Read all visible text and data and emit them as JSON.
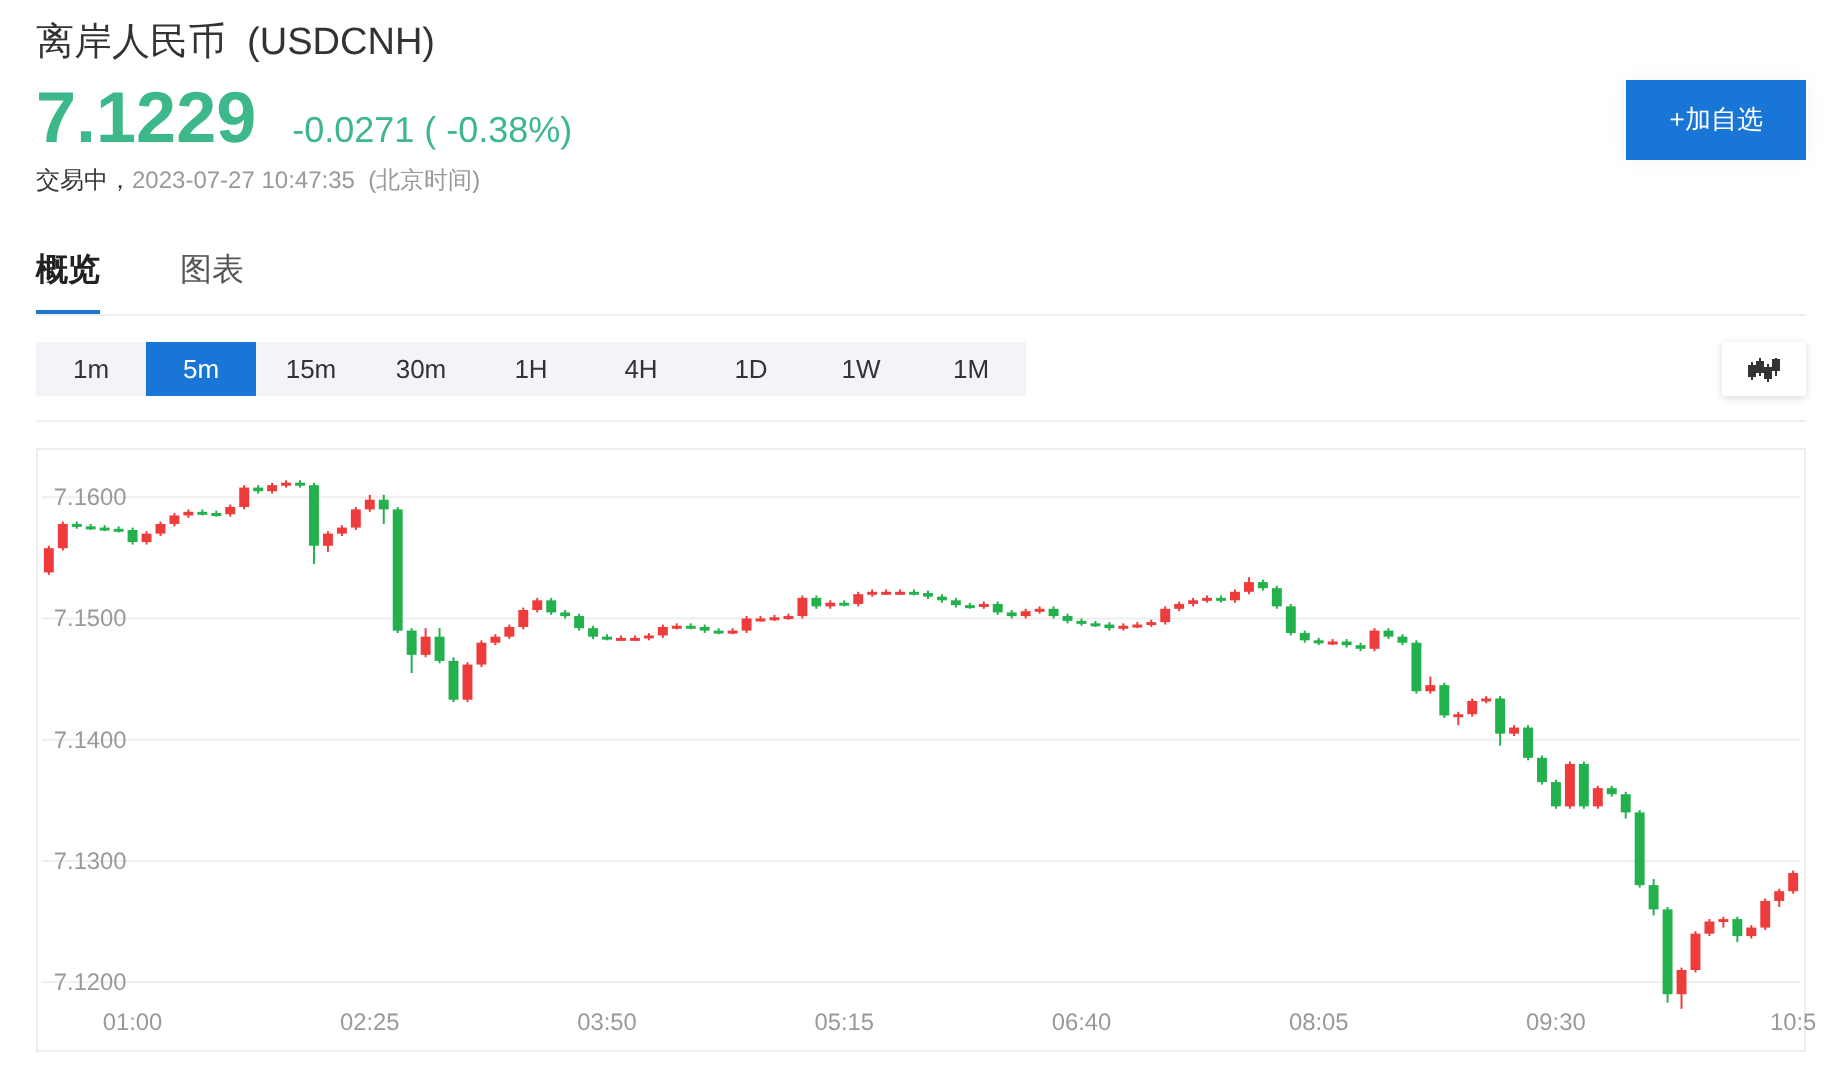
{
  "header": {
    "title": "离岸人民币  (USDCNH)",
    "price": "7.1229",
    "change": "-0.0271 ( -0.38%)",
    "status": "交易中，",
    "time": "2023-07-27 10:47:35  (北京时间)",
    "watch_button": "+加自选"
  },
  "tabs": [
    {
      "label": "概览",
      "selected": true
    },
    {
      "label": "图表",
      "selected": false
    }
  ],
  "periods": [
    {
      "label": "1m",
      "selected": false
    },
    {
      "label": "5m",
      "selected": true
    },
    {
      "label": "15m",
      "selected": false
    },
    {
      "label": "30m",
      "selected": false
    },
    {
      "label": "1H",
      "selected": false
    },
    {
      "label": "4H",
      "selected": false
    },
    {
      "label": "1D",
      "selected": false
    },
    {
      "label": "1W",
      "selected": false
    },
    {
      "label": "1M",
      "selected": false
    }
  ],
  "chart": {
    "chart_data": {
      "type": "candlestick",
      "grid": true,
      "ylim": [
        7.1144,
        7.1639
      ],
      "yticks": [
        {
          "value": 7.16,
          "label": "7.1600"
        },
        {
          "value": 7.15,
          "label": "7.1500"
        },
        {
          "value": 7.14,
          "label": "7.1400"
        },
        {
          "value": 7.13,
          "label": "7.1300"
        },
        {
          "value": 7.12,
          "label": "7.1200"
        }
      ],
      "categories": [
        null,
        null,
        null,
        null,
        null,
        null,
        "01:00",
        null,
        null,
        null,
        null,
        null,
        null,
        null,
        null,
        null,
        null,
        null,
        null,
        null,
        null,
        null,
        null,
        "02:25",
        null,
        null,
        null,
        null,
        null,
        null,
        null,
        null,
        null,
        null,
        null,
        null,
        null,
        null,
        null,
        null,
        "03:50",
        null,
        null,
        null,
        null,
        null,
        null,
        null,
        null,
        null,
        null,
        null,
        null,
        null,
        null,
        null,
        null,
        "05:15",
        null,
        null,
        null,
        null,
        null,
        null,
        null,
        null,
        null,
        null,
        null,
        null,
        null,
        null,
        null,
        null,
        "06:40",
        null,
        null,
        null,
        null,
        null,
        null,
        null,
        null,
        null,
        null,
        null,
        null,
        null,
        null,
        null,
        null,
        "08:05",
        null,
        null,
        null,
        null,
        null,
        null,
        null,
        null,
        null,
        null,
        null,
        null,
        null,
        null,
        null,
        null,
        "09:30",
        null,
        null,
        null,
        null,
        null,
        null,
        null,
        null,
        null,
        null,
        null,
        null,
        null,
        null,
        null,
        null,
        "10:5"
      ],
      "ohlc": [
        [
          7.1538,
          7.156,
          7.1536,
          7.1558
        ],
        [
          7.1558,
          7.158,
          7.1556,
          7.1578
        ],
        [
          7.1578,
          7.158,
          7.1574,
          7.1576
        ],
        [
          7.1576,
          7.1578,
          7.1573,
          7.1575
        ],
        [
          7.1575,
          7.1577,
          7.1572,
          7.1574
        ],
        [
          7.1574,
          7.1576,
          7.1571,
          7.1573
        ],
        [
          7.1573,
          7.1575,
          7.1561,
          7.1563
        ],
        [
          7.1563,
          7.1572,
          7.1561,
          7.157
        ],
        [
          7.157,
          7.158,
          7.1568,
          7.1578
        ],
        [
          7.1578,
          7.1587,
          7.1576,
          7.1585
        ],
        [
          7.1585,
          7.159,
          7.1583,
          7.1588
        ],
        [
          7.1588,
          7.159,
          7.1585,
          7.1587
        ],
        [
          7.1587,
          7.1589,
          7.1584,
          7.1586
        ],
        [
          7.1586,
          7.1594,
          7.1584,
          7.1592
        ],
        [
          7.1592,
          7.161,
          7.159,
          7.1608
        ],
        [
          7.1608,
          7.161,
          7.1603,
          7.1605
        ],
        [
          7.1605,
          7.1612,
          7.1603,
          7.161
        ],
        [
          7.161,
          7.1614,
          7.1608,
          7.1612
        ],
        [
          7.1612,
          7.1614,
          7.1608,
          7.161
        ],
        [
          7.161,
          7.1612,
          7.1545,
          7.156
        ],
        [
          7.156,
          7.1572,
          7.1555,
          7.157
        ],
        [
          7.157,
          7.1577,
          7.1568,
          7.1575
        ],
        [
          7.1575,
          7.1592,
          7.1573,
          7.159
        ],
        [
          7.159,
          7.1602,
          7.1588,
          7.1598
        ],
        [
          7.1598,
          7.1602,
          7.1578,
          7.159
        ],
        [
          7.159,
          7.1592,
          7.1488,
          7.149
        ],
        [
          7.149,
          7.1492,
          7.1455,
          7.147
        ],
        [
          7.147,
          7.1492,
          7.1468,
          7.1485
        ],
        [
          7.1485,
          7.1492,
          7.1463,
          7.1465
        ],
        [
          7.1465,
          7.1468,
          7.1431,
          7.1433
        ],
        [
          7.1433,
          7.1464,
          7.1431,
          7.1462
        ],
        [
          7.1462,
          7.1482,
          7.146,
          7.148
        ],
        [
          7.148,
          7.1487,
          7.1478,
          7.1485
        ],
        [
          7.1485,
          7.1495,
          7.1483,
          7.1493
        ],
        [
          7.1493,
          7.1509,
          7.1491,
          7.1507
        ],
        [
          7.1507,
          7.1517,
          7.1505,
          7.1515
        ],
        [
          7.1515,
          7.1517,
          7.1503,
          7.1505
        ],
        [
          7.1505,
          7.1507,
          7.15,
          7.1502
        ],
        [
          7.1502,
          7.1504,
          7.149,
          7.1492
        ],
        [
          7.1492,
          7.1494,
          7.1483,
          7.1485
        ],
        [
          7.1485,
          7.1487,
          7.1482,
          7.1484
        ],
        [
          7.1484,
          7.1486,
          7.1482,
          7.1484
        ],
        [
          7.1484,
          7.1486,
          7.1482,
          7.1484
        ],
        [
          7.1484,
          7.1488,
          7.1482,
          7.1486
        ],
        [
          7.1486,
          7.1495,
          7.1484,
          7.1493
        ],
        [
          7.1493,
          7.1496,
          7.1491,
          7.1494
        ],
        [
          7.1494,
          7.1496,
          7.1491,
          7.1493
        ],
        [
          7.1493,
          7.1495,
          7.1488,
          7.149
        ],
        [
          7.149,
          7.1492,
          7.1487,
          7.1489
        ],
        [
          7.1489,
          7.1492,
          7.1487,
          7.149
        ],
        [
          7.149,
          7.1502,
          7.1488,
          7.15
        ],
        [
          7.15,
          7.1502,
          7.1498,
          7.15
        ],
        [
          7.15,
          7.1503,
          7.1498,
          7.1501
        ],
        [
          7.1501,
          7.1504,
          7.1499,
          7.1502
        ],
        [
          7.1502,
          7.1519,
          7.15,
          7.1517
        ],
        [
          7.1517,
          7.1519,
          7.1508,
          7.151
        ],
        [
          7.151,
          7.1515,
          7.1508,
          7.1513
        ],
        [
          7.1513,
          7.1515,
          7.151,
          7.1512
        ],
        [
          7.1512,
          7.1522,
          7.151,
          7.152
        ],
        [
          7.152,
          7.1524,
          7.1518,
          7.1522
        ],
        [
          7.1522,
          7.1524,
          7.152,
          7.1522
        ],
        [
          7.1522,
          7.1524,
          7.152,
          7.1522
        ],
        [
          7.1522,
          7.1524,
          7.1519,
          7.1521
        ],
        [
          7.1521,
          7.1523,
          7.1516,
          7.1518
        ],
        [
          7.1518,
          7.152,
          7.1513,
          7.1515
        ],
        [
          7.1515,
          7.1517,
          7.1509,
          7.1511
        ],
        [
          7.1511,
          7.1513,
          7.1508,
          7.151
        ],
        [
          7.151,
          7.1514,
          7.1508,
          7.1512
        ],
        [
          7.1512,
          7.1514,
          7.1503,
          7.1505
        ],
        [
          7.1505,
          7.1507,
          7.15,
          7.1502
        ],
        [
          7.1502,
          7.1508,
          7.15,
          7.1506
        ],
        [
          7.1506,
          7.151,
          7.1504,
          7.1508
        ],
        [
          7.1508,
          7.151,
          7.15,
          7.1502
        ],
        [
          7.1502,
          7.1504,
          7.1496,
          7.1498
        ],
        [
          7.1498,
          7.15,
          7.1494,
          7.1496
        ],
        [
          7.1496,
          7.1498,
          7.1493,
          7.1495
        ],
        [
          7.1495,
          7.1497,
          7.149,
          7.1492
        ],
        [
          7.1492,
          7.1496,
          7.149,
          7.1494
        ],
        [
          7.1494,
          7.1497,
          7.1492,
          7.1495
        ],
        [
          7.1495,
          7.1499,
          7.1493,
          7.1497
        ],
        [
          7.1497,
          7.151,
          7.1495,
          7.1508
        ],
        [
          7.1508,
          7.1514,
          7.1506,
          7.1512
        ],
        [
          7.1512,
          7.1517,
          7.151,
          7.1515
        ],
        [
          7.1515,
          7.1519,
          7.1513,
          7.1517
        ],
        [
          7.1517,
          7.1519,
          7.1513,
          7.1515
        ],
        [
          7.1515,
          7.1524,
          7.1513,
          7.1522
        ],
        [
          7.1522,
          7.1534,
          7.152,
          7.153
        ],
        [
          7.153,
          7.1532,
          7.1523,
          7.1525
        ],
        [
          7.1525,
          7.1527,
          7.1508,
          7.151
        ],
        [
          7.151,
          7.1512,
          7.1486,
          7.1488
        ],
        [
          7.1488,
          7.149,
          7.148,
          7.1482
        ],
        [
          7.1482,
          7.1484,
          7.1478,
          7.148
        ],
        [
          7.148,
          7.1483,
          7.1478,
          7.1481
        ],
        [
          7.1481,
          7.1483,
          7.1476,
          7.1478
        ],
        [
          7.1478,
          7.148,
          7.1473,
          7.1475
        ],
        [
          7.1475,
          7.1492,
          7.1473,
          7.149
        ],
        [
          7.149,
          7.1492,
          7.1483,
          7.1485
        ],
        [
          7.1485,
          7.1487,
          7.1478,
          7.148
        ],
        [
          7.148,
          7.1482,
          7.1438,
          7.144
        ],
        [
          7.144,
          7.1452,
          7.1438,
          7.1445
        ],
        [
          7.1445,
          7.1447,
          7.1418,
          7.142
        ],
        [
          7.142,
          7.1423,
          7.1412,
          7.1421
        ],
        [
          7.1421,
          7.1434,
          7.1419,
          7.1432
        ],
        [
          7.1432,
          7.1436,
          7.143,
          7.1434
        ],
        [
          7.1434,
          7.1436,
          7.1395,
          7.1405
        ],
        [
          7.1405,
          7.1412,
          7.1403,
          7.141
        ],
        [
          7.141,
          7.1412,
          7.1383,
          7.1385
        ],
        [
          7.1385,
          7.1387,
          7.1363,
          7.1365
        ],
        [
          7.1365,
          7.1367,
          7.1343,
          7.1345
        ],
        [
          7.1345,
          7.1382,
          7.1343,
          7.138
        ],
        [
          7.138,
          7.1382,
          7.1343,
          7.1345
        ],
        [
          7.1345,
          7.1362,
          7.1343,
          7.136
        ],
        [
          7.136,
          7.1362,
          7.1353,
          7.1355
        ],
        [
          7.1355,
          7.1357,
          7.1335,
          7.134
        ],
        [
          7.134,
          7.1342,
          7.1278,
          7.128
        ],
        [
          7.128,
          7.1285,
          7.1255,
          7.126
        ],
        [
          7.126,
          7.1262,
          7.1183,
          7.119
        ],
        [
          7.119,
          7.1212,
          7.1178,
          7.121
        ],
        [
          7.121,
          7.1242,
          7.1208,
          7.124
        ],
        [
          7.124,
          7.1252,
          7.1238,
          7.125
        ],
        [
          7.125,
          7.1254,
          7.1245,
          7.1252
        ],
        [
          7.1252,
          7.1254,
          7.1233,
          7.1238
        ],
        [
          7.1238,
          7.1247,
          7.1236,
          7.1245
        ],
        [
          7.1245,
          7.1269,
          7.1243,
          7.1267
        ],
        [
          7.1267,
          7.1277,
          7.1262,
          7.1275
        ],
        [
          7.1275,
          7.1292,
          7.1273,
          7.129
        ]
      ]
    }
  }
}
